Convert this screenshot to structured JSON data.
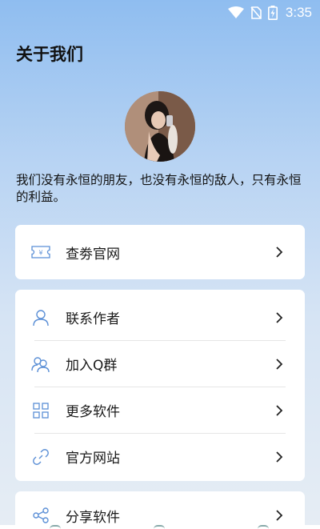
{
  "status_bar": {
    "time": "3:35",
    "icons": [
      "wifi-icon",
      "no-sim-icon",
      "battery-charging-icon"
    ]
  },
  "header": {
    "title": "关于我们"
  },
  "profile": {
    "motto": "我们没有永恒的朋友，也没有永恒的敌人，只有永恒的利益。"
  },
  "menu": {
    "group1": [
      {
        "label": "查劵官网",
        "icon": "coupon-ticket-icon"
      }
    ],
    "group2": [
      {
        "label": "联系作者",
        "icon": "person-icon"
      },
      {
        "label": "加入Q群",
        "icon": "group-icon"
      },
      {
        "label": "更多软件",
        "icon": "apps-grid-icon"
      },
      {
        "label": "官方网站",
        "icon": "link-icon"
      }
    ],
    "group3": [
      {
        "label": "分享软件",
        "icon": "share-icon"
      }
    ]
  },
  "colors": {
    "accent_icon": "#5b8fd6",
    "background_top": "#8fbdf0",
    "background_bottom": "#e6edf4"
  }
}
